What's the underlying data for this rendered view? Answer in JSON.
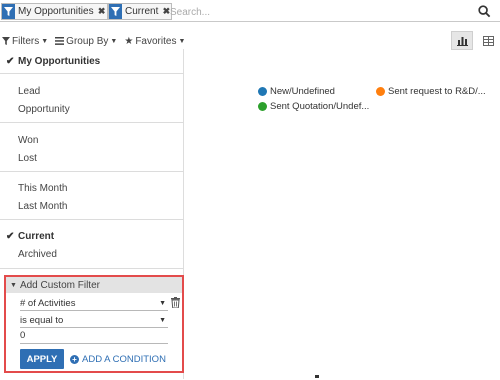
{
  "search": {
    "facets": [
      {
        "label": "My Opportunities",
        "icon": "filter-icon"
      },
      {
        "label": "Current",
        "icon": "filter-icon"
      }
    ],
    "placeholder": "Search..."
  },
  "toolbar": {
    "filters_label": "Filters",
    "groupby_label": "Group By",
    "favorites_label": "Favorites"
  },
  "legend": [
    {
      "label": "New/Undefined",
      "color": "#1f77b4"
    },
    {
      "label": "Sent request to R&D/...",
      "color": "#ff7f0e"
    },
    {
      "label": "Sent Quotation/Undef...",
      "color": "#2ca02c"
    }
  ],
  "filters_menu": {
    "groups": [
      [
        {
          "label": "My Opportunities",
          "checked": true
        }
      ],
      [
        {
          "label": "Lead",
          "checked": false
        },
        {
          "label": "Opportunity",
          "checked": false
        }
      ],
      [
        {
          "label": "Won",
          "checked": false
        },
        {
          "label": "Lost",
          "checked": false
        }
      ],
      [
        {
          "label": "This Month",
          "checked": false
        },
        {
          "label": "Last Month",
          "checked": false
        }
      ],
      [
        {
          "label": "Current",
          "checked": true
        },
        {
          "label": "Archived",
          "checked": false
        }
      ]
    ]
  },
  "custom_filter": {
    "header": "Add Custom Filter",
    "field": "# of Activities",
    "operator": "is equal to",
    "value": "0",
    "apply_label": "APPLY",
    "add_condition_label": "ADD A CONDITION"
  },
  "colors": {
    "accent": "#2f6fb4",
    "highlight_border": "#e34b4b"
  }
}
